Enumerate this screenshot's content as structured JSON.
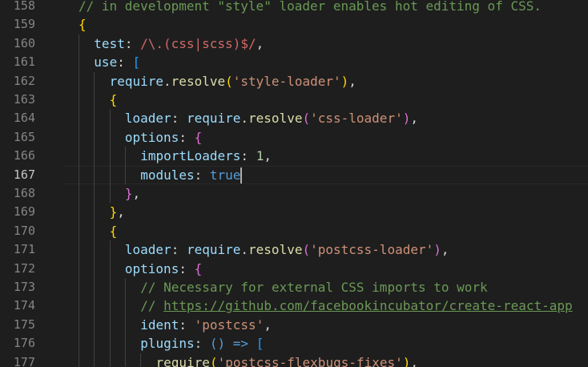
{
  "editor": {
    "active_line": 167,
    "lines": [
      {
        "n": 158,
        "indent": 4,
        "tokens": [
          {
            "t": "// in development \"style\" loader enables hot editing of CSS.",
            "c": "cmt"
          }
        ]
      },
      {
        "n": 159,
        "indent": 4,
        "tokens": [
          {
            "t": "{",
            "c": "br1"
          }
        ]
      },
      {
        "n": 160,
        "indent": 5,
        "tokens": [
          {
            "t": "test",
            "c": "prop"
          },
          {
            "t": ": ",
            "c": "pn"
          },
          {
            "t": "/\\.(css|scss)$/",
            "c": "rgx"
          },
          {
            "t": ",",
            "c": "pn"
          }
        ]
      },
      {
        "n": 161,
        "indent": 5,
        "tokens": [
          {
            "t": "use",
            "c": "prop"
          },
          {
            "t": ": ",
            "c": "pn"
          },
          {
            "t": "[",
            "c": "br3"
          }
        ]
      },
      {
        "n": 162,
        "indent": 6,
        "tokens": [
          {
            "t": "require",
            "c": "prop"
          },
          {
            "t": ".",
            "c": "pn"
          },
          {
            "t": "resolve",
            "c": "fn"
          },
          {
            "t": "(",
            "c": "br1"
          },
          {
            "t": "'style-loader'",
            "c": "str"
          },
          {
            "t": ")",
            "c": "br1"
          },
          {
            "t": ",",
            "c": "pn"
          }
        ]
      },
      {
        "n": 163,
        "indent": 6,
        "tokens": [
          {
            "t": "{",
            "c": "br1"
          }
        ]
      },
      {
        "n": 164,
        "indent": 7,
        "tokens": [
          {
            "t": "loader",
            "c": "prop"
          },
          {
            "t": ": ",
            "c": "pn"
          },
          {
            "t": "require",
            "c": "prop"
          },
          {
            "t": ".",
            "c": "pn"
          },
          {
            "t": "resolve",
            "c": "fn"
          },
          {
            "t": "(",
            "c": "br2"
          },
          {
            "t": "'css-loader'",
            "c": "str"
          },
          {
            "t": ")",
            "c": "br2"
          },
          {
            "t": ",",
            "c": "pn"
          }
        ]
      },
      {
        "n": 165,
        "indent": 7,
        "tokens": [
          {
            "t": "options",
            "c": "prop"
          },
          {
            "t": ": ",
            "c": "pn"
          },
          {
            "t": "{",
            "c": "br2"
          }
        ]
      },
      {
        "n": 166,
        "indent": 8,
        "tokens": [
          {
            "t": "importLoaders",
            "c": "prop"
          },
          {
            "t": ": ",
            "c": "pn"
          },
          {
            "t": "1",
            "c": "num"
          },
          {
            "t": ",",
            "c": "pn"
          }
        ]
      },
      {
        "n": 167,
        "indent": 8,
        "tokens": [
          {
            "t": "modules",
            "c": "prop"
          },
          {
            "t": ": ",
            "c": "pn"
          },
          {
            "t": "true",
            "c": "kw"
          }
        ]
      },
      {
        "n": 168,
        "indent": 7,
        "tokens": [
          {
            "t": "}",
            "c": "br2"
          },
          {
            "t": ",",
            "c": "pn"
          }
        ]
      },
      {
        "n": 169,
        "indent": 6,
        "tokens": [
          {
            "t": "}",
            "c": "br1"
          },
          {
            "t": ",",
            "c": "pn"
          }
        ]
      },
      {
        "n": 170,
        "indent": 6,
        "tokens": [
          {
            "t": "{",
            "c": "br1"
          }
        ]
      },
      {
        "n": 171,
        "indent": 7,
        "tokens": [
          {
            "t": "loader",
            "c": "prop"
          },
          {
            "t": ": ",
            "c": "pn"
          },
          {
            "t": "require",
            "c": "prop"
          },
          {
            "t": ".",
            "c": "pn"
          },
          {
            "t": "resolve",
            "c": "fn"
          },
          {
            "t": "(",
            "c": "br2"
          },
          {
            "t": "'postcss-loader'",
            "c": "str"
          },
          {
            "t": ")",
            "c": "br2"
          },
          {
            "t": ",",
            "c": "pn"
          }
        ]
      },
      {
        "n": 172,
        "indent": 7,
        "tokens": [
          {
            "t": "options",
            "c": "prop"
          },
          {
            "t": ": ",
            "c": "pn"
          },
          {
            "t": "{",
            "c": "br2"
          }
        ]
      },
      {
        "n": 173,
        "indent": 8,
        "tokens": [
          {
            "t": "// Necessary for external CSS imports to work",
            "c": "cmt"
          }
        ]
      },
      {
        "n": 174,
        "indent": 8,
        "tokens": [
          {
            "t": "// ",
            "c": "cmt"
          },
          {
            "t": "https://github.com/facebookincubator/create-react-app",
            "c": "lnk"
          }
        ]
      },
      {
        "n": 175,
        "indent": 8,
        "tokens": [
          {
            "t": "ident",
            "c": "prop"
          },
          {
            "t": ": ",
            "c": "pn"
          },
          {
            "t": "'postcss'",
            "c": "str"
          },
          {
            "t": ",",
            "c": "pn"
          }
        ]
      },
      {
        "n": 176,
        "indent": 8,
        "tokens": [
          {
            "t": "plugins",
            "c": "prop"
          },
          {
            "t": ": ",
            "c": "pn"
          },
          {
            "t": "() => ",
            "c": "kw"
          },
          {
            "t": "[",
            "c": "br3"
          }
        ]
      },
      {
        "n": 177,
        "indent": 9,
        "tokens": [
          {
            "t": "require",
            "c": "fn"
          },
          {
            "t": "(",
            "c": "br1"
          },
          {
            "t": "'postcss-flexbugs-fixes'",
            "c": "str"
          },
          {
            "t": ")",
            "c": "br1"
          },
          {
            "t": ",",
            "c": "pn"
          }
        ]
      }
    ]
  }
}
